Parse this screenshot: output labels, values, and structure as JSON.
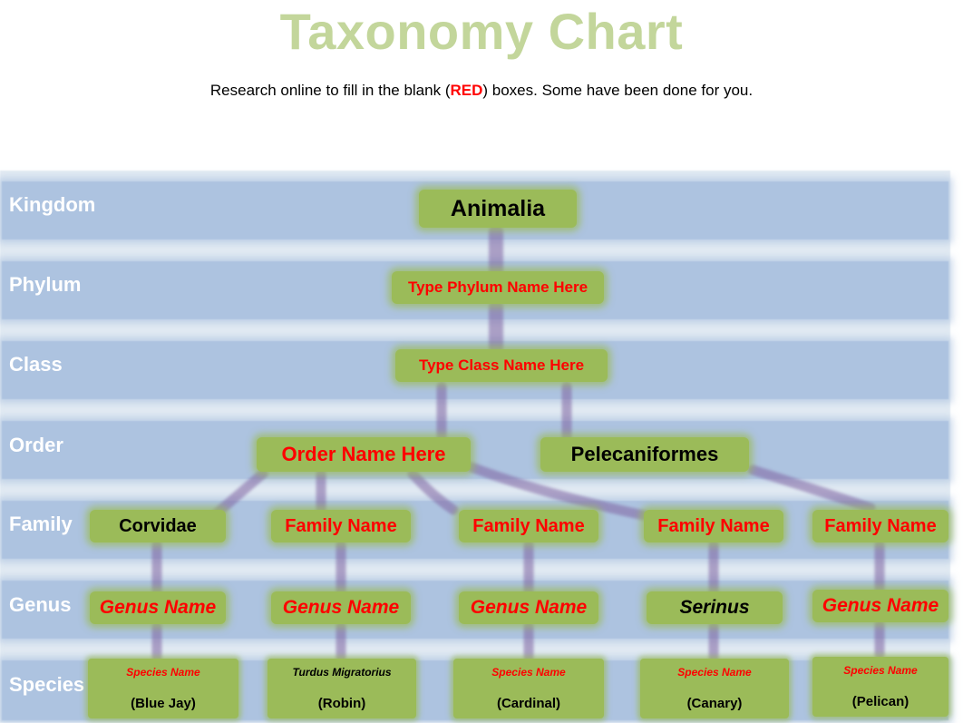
{
  "header": {
    "title": "Taxonomy Chart",
    "instruction_before": "Research online to fill in the blank (",
    "instruction_highlight": "RED",
    "instruction_after": ") boxes.  Some have been done for you."
  },
  "colors": {
    "title": "#c3d69b",
    "band": "#adc3e0",
    "node": "#9bbb59",
    "connector": "#8064a2",
    "blank_text": "#ff0000",
    "filled_text": "#000000"
  },
  "ranks": [
    "Kingdom",
    "Phylum",
    "Class",
    "Order",
    "Family",
    "Genus",
    "Species"
  ],
  "nodes": {
    "kingdom": {
      "text": "Animalia",
      "blank": false
    },
    "phylum": {
      "text": "Type Phylum Name Here",
      "blank": true
    },
    "class": {
      "text": "Type Class Name Here",
      "blank": true
    },
    "orders": [
      {
        "text": "Order Name Here",
        "blank": true
      },
      {
        "text": "Pelecaniformes",
        "blank": false
      }
    ],
    "families": [
      {
        "text": "Corvidae",
        "blank": false
      },
      {
        "text": "Family Name",
        "blank": true
      },
      {
        "text": "Family Name",
        "blank": true
      },
      {
        "text": "Family Name",
        "blank": true
      },
      {
        "text": "Family Name",
        "blank": true
      }
    ],
    "genera": [
      {
        "text": "Genus Name",
        "blank": true
      },
      {
        "text": "Genus Name",
        "blank": true
      },
      {
        "text": "Genus Name",
        "blank": true
      },
      {
        "text": "Serinus",
        "blank": false
      },
      {
        "text": "Genus Name",
        "blank": true
      }
    ],
    "species": [
      {
        "scientific": "Species Name",
        "common": "(Blue Jay)",
        "blank": true
      },
      {
        "scientific": "Turdus Migratorius",
        "common": "(Robin)",
        "blank": false
      },
      {
        "scientific": "Species Name",
        "common": "(Cardinal)",
        "blank": true
      },
      {
        "scientific": "Species Name",
        "common": "(Canary)",
        "blank": true
      },
      {
        "scientific": "Species Name",
        "common": "(Pelican)",
        "blank": true
      }
    ]
  }
}
